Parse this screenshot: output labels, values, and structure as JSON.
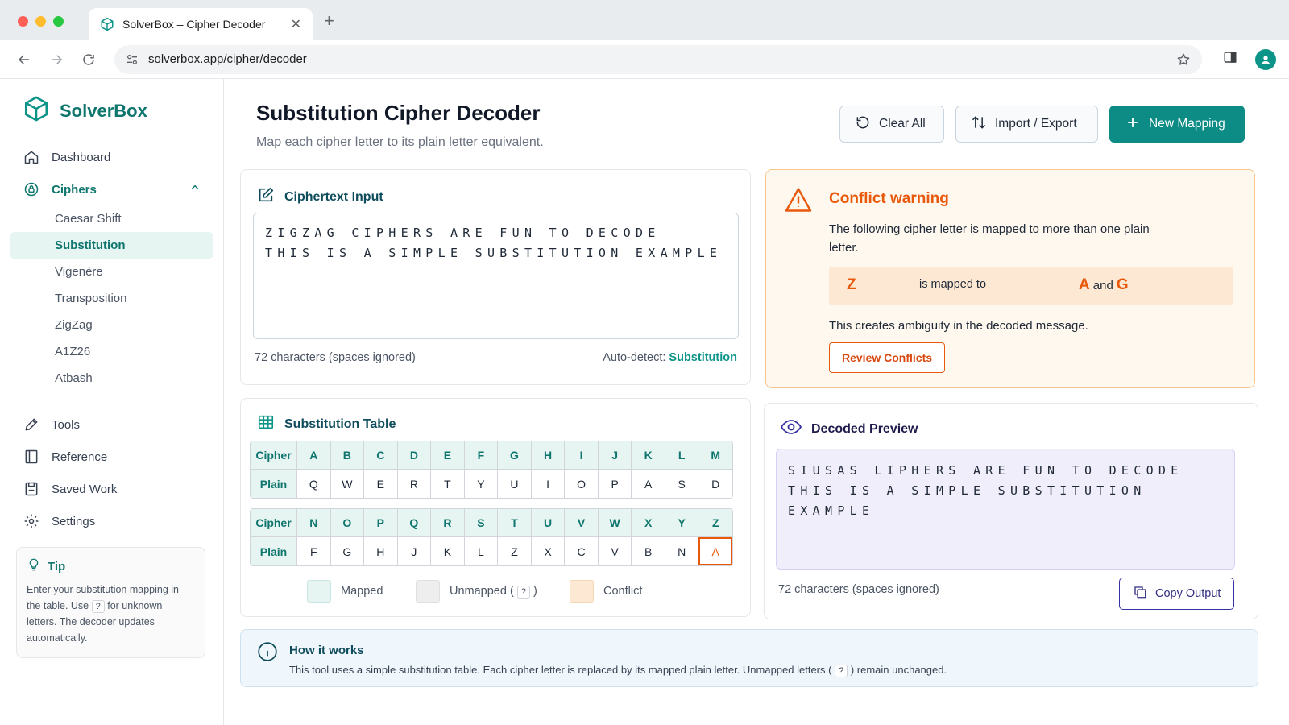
{
  "browser": {
    "tab_title": "SolverBox – Cipher Decoder",
    "url": "solverbox.app/cipher/decoder"
  },
  "brand": {
    "name": "SolverBox"
  },
  "sidebar": {
    "items": [
      {
        "label": "Dashboard",
        "icon": "home-icon"
      },
      {
        "label": "Ciphers",
        "icon": "cipher-icon"
      },
      {
        "label": "Tools",
        "icon": "pencil-icon"
      },
      {
        "label": "Reference",
        "icon": "book-icon"
      },
      {
        "label": "Saved Work",
        "icon": "save-icon"
      },
      {
        "label": "Settings",
        "icon": "gear-icon"
      }
    ],
    "cipher_subitems": [
      "Caesar Shift",
      "Substitution",
      "Vigenère",
      "Transposition",
      "ZigZag",
      "A1Z26",
      "Atbash"
    ],
    "tip": {
      "title": "Tip",
      "text_1": "Enter your substitution mapping in the table. Use",
      "unknown_glyph": "?",
      "text_2": "for unknown letters. The decoder updates automatically."
    }
  },
  "header": {
    "title": "Substitution Cipher Decoder",
    "subtitle": "Map each cipher letter to its plain letter equivalent.",
    "clear_label": "Clear All",
    "import_label": "Import / Export",
    "new_label": "New Mapping"
  },
  "input_card": {
    "title": "Ciphertext Input",
    "line1": "ZIGZAG CIPHERS ARE FUN TO DECODE",
    "line2": "THIS IS A SIMPLE SUBSTITUTION EXAMPLE",
    "char_count": "72 characters (spaces ignored)",
    "autodetect_label": "Auto-detect:",
    "autodetect_value": "Substitution"
  },
  "warning": {
    "title": "Conflict warning",
    "text": "The following cipher letter is mapped to more than one plain letter.",
    "cipher_letter": "Z",
    "mapped_text": "is mapped to",
    "plain_a": "A",
    "and_text": "and",
    "plain_b": "G",
    "ambiguity": "This creates ambiguity in the decoded message.",
    "review_label": "Review Conflicts"
  },
  "table": {
    "title": "Substitution Table",
    "cipher_label": "Cipher",
    "plain_label": "Plain",
    "row1_cipher": [
      "A",
      "B",
      "C",
      "D",
      "E",
      "F",
      "G",
      "H",
      "I",
      "J",
      "K",
      "L",
      "M"
    ],
    "row1_plain": [
      "Q",
      "W",
      "E",
      "R",
      "T",
      "Y",
      "U",
      "I",
      "O",
      "P",
      "A",
      "S",
      "D"
    ],
    "row2_cipher": [
      "N",
      "O",
      "P",
      "Q",
      "R",
      "S",
      "T",
      "U",
      "V",
      "W",
      "X",
      "Y",
      "Z"
    ],
    "row2_plain": [
      "F",
      "G",
      "H",
      "J",
      "K",
      "L",
      "Z",
      "X",
      "C",
      "V",
      "B",
      "N",
      "A"
    ],
    "conflict_cell": "Z",
    "legend": {
      "mapped": "Mapped",
      "unmapped_1": "Unmapped (",
      "unmapped_q": "?",
      "unmapped_2": ")",
      "conflict": "Conflict"
    },
    "colors": {
      "mapped": "#e6f4f2",
      "unmapped": "#eeeeee",
      "conflict": "#fde9d3"
    }
  },
  "preview": {
    "title": "Decoded Preview",
    "line1": "SIUSAS LIPHERS ARE FUN TO DECODE",
    "line2": "THIS IS A SIMPLE SUBSTITUTION EXAMPLE",
    "char_count": "72 characters (spaces ignored)",
    "copy_label": "Copy Output"
  },
  "how": {
    "title": "How it works",
    "text_1": "This tool uses a simple substitution table. Each cipher letter is replaced by its mapped plain letter. Unmapped letters (",
    "glyph": "?",
    "text_2": ") remain unchanged."
  },
  "colors": {
    "accent": "#0d8b85",
    "warning": "#e8590c",
    "preview_bg": "#f1eefc"
  }
}
